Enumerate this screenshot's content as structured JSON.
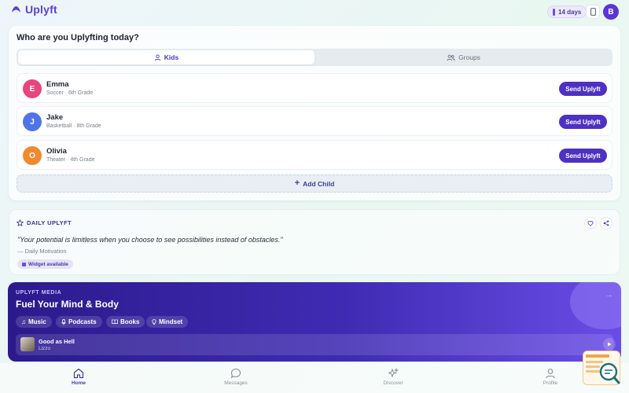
{
  "app": {
    "name": "Uplyft"
  },
  "header": {
    "streak": "14 days",
    "user_initial": "B"
  },
  "who": {
    "title": "Who are you Uplyfting today?",
    "tabs": [
      {
        "label": "Kids",
        "active": true
      },
      {
        "label": "Groups",
        "active": false
      }
    ],
    "kids": [
      {
        "initial": "E",
        "name": "Emma",
        "details": "Soccer · 6th Grade",
        "color": "#e8457a",
        "action": "Send Uplyft"
      },
      {
        "initial": "J",
        "name": "Jake",
        "details": "Basketball · 8th Grade",
        "color": "#4f73e8",
        "action": "Send Uplyft"
      },
      {
        "initial": "O",
        "name": "Olivia",
        "details": "Theater · 4th Grade",
        "color": "#f08a2e",
        "action": "Send Uplyft"
      }
    ],
    "add_child": "Add Child"
  },
  "daily": {
    "label": "DAILY UPLYFT",
    "quote": "\"Your potential is limitless when you choose to see possibilities instead of obstacles.\"",
    "source": "— Daily Motivation",
    "badge": "Widget available"
  },
  "media": {
    "label": "UPLYFT MEDIA",
    "title": "Fuel Your Mind & Body",
    "chips": [
      {
        "label": "Music",
        "icon": "music-note-icon"
      },
      {
        "label": "Podcasts",
        "icon": "microphone-icon"
      },
      {
        "label": "Books",
        "icon": "book-icon"
      },
      {
        "label": "Mindset",
        "icon": "lightbulb-icon"
      }
    ],
    "now_playing": {
      "title": "Good as Hell",
      "artist": "Lizzo"
    }
  },
  "nav": [
    {
      "label": "Home",
      "icon": "home-icon",
      "active": true
    },
    {
      "label": "Messages",
      "icon": "chat-bubble-icon",
      "active": false
    },
    {
      "label": "Discover",
      "icon": "sparkles-icon",
      "active": false
    },
    {
      "label": "Profile",
      "icon": "user-icon",
      "active": false
    }
  ],
  "colors": {
    "brand": "#5b3fd1",
    "button": "#4d31c4",
    "media_start": "#2c1a8c",
    "media_end": "#6a4de6"
  }
}
